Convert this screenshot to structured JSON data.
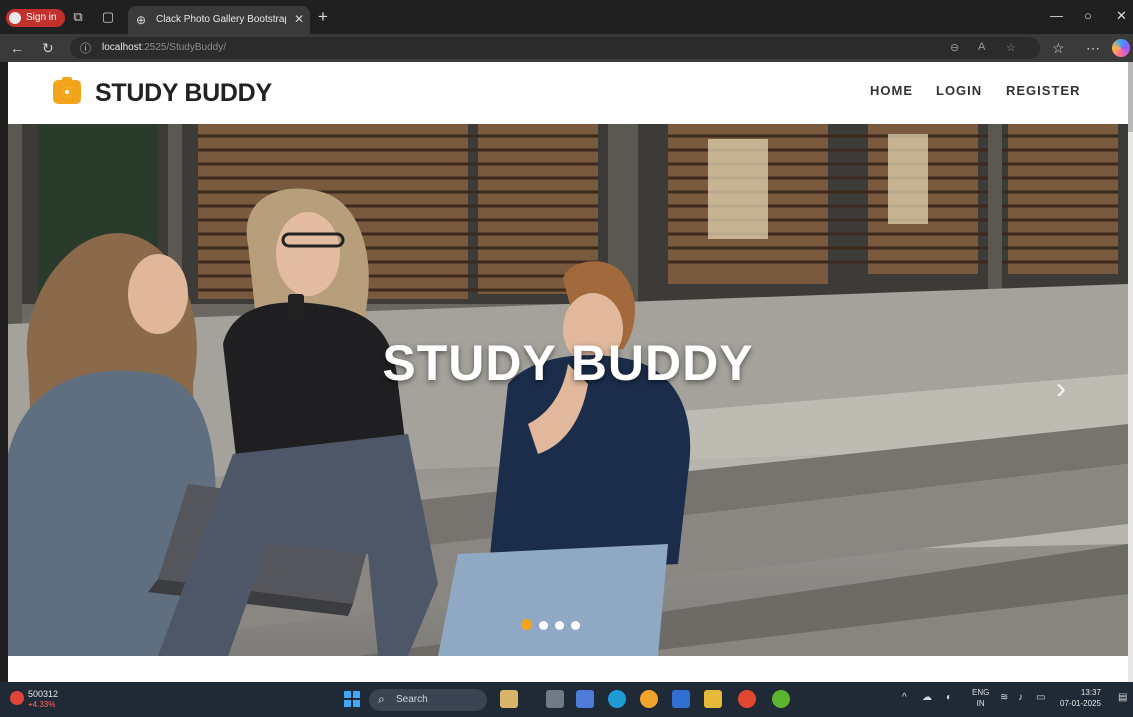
{
  "browser": {
    "signin_label": "Sign in",
    "tab_title": "Clack Photo Gallery Bootstrap Re",
    "url_host": "localhost",
    "url_path": ":2525/StudyBuddy/"
  },
  "site": {
    "brand": "STUDY BUDDY",
    "nav": {
      "home": "HOME",
      "login": "LOGIN",
      "register": "REGISTER"
    },
    "hero_title": "STUDY BUDDY",
    "carousel": {
      "slides": 4,
      "active_index": 0
    }
  },
  "taskbar": {
    "stock_name": "500312",
    "stock_change": "+4.33%",
    "search_label": "Search",
    "lang_line1": "ENG",
    "lang_line2": "IN",
    "time": "13:37",
    "date": "07-01-2025"
  },
  "colors": {
    "accent": "#f2a51a",
    "brand_text": "#222222",
    "signin": "#c4302b"
  }
}
